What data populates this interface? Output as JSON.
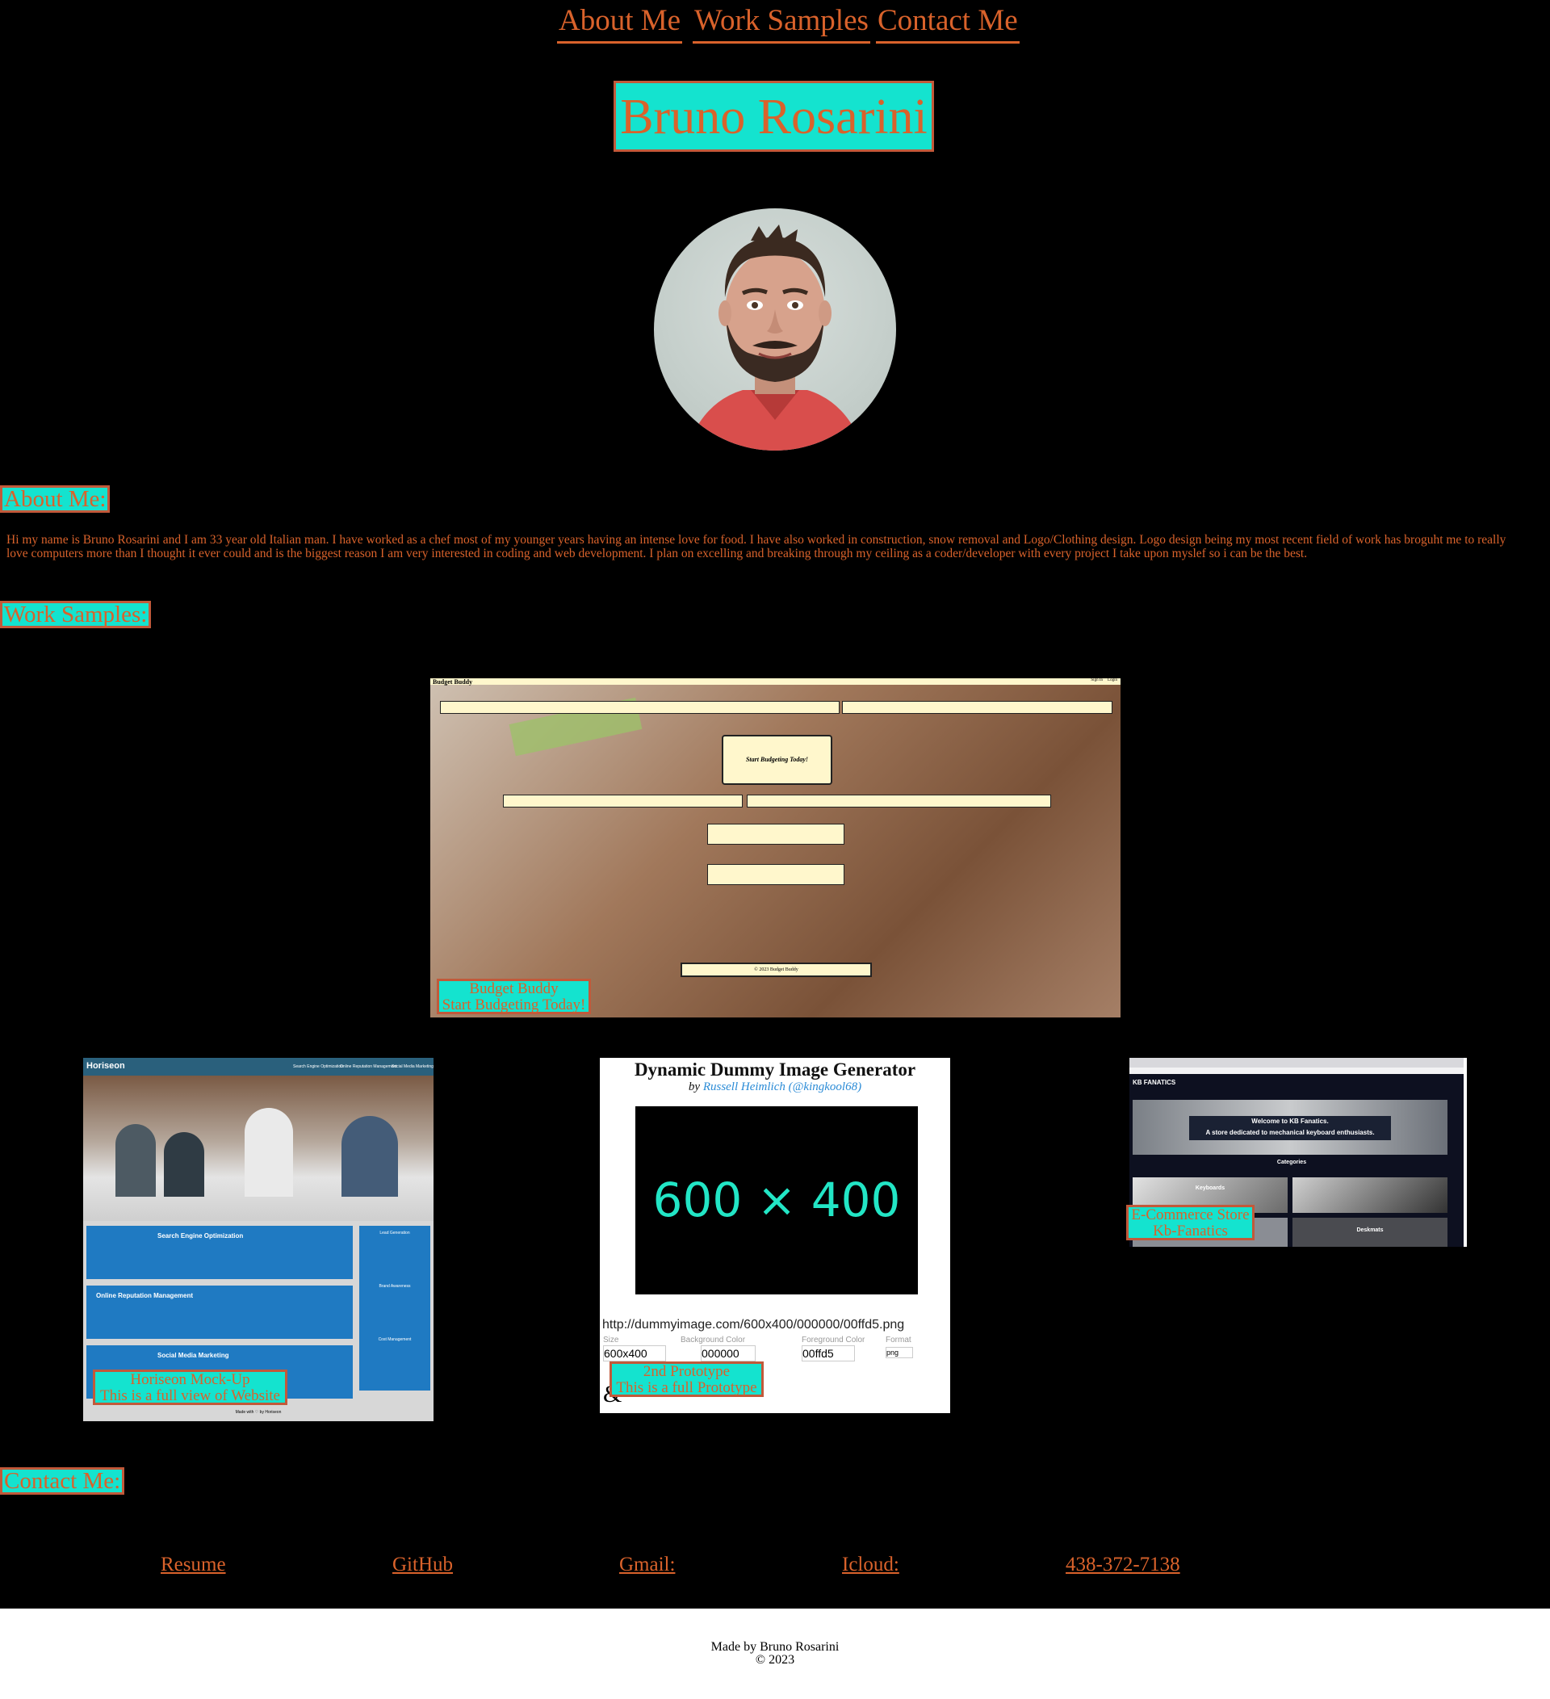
{
  "nav": {
    "about": "About Me",
    "work": "Work Samples",
    "contact": "Contact Me"
  },
  "header": {
    "title": "Bruno Rosarini"
  },
  "about": {
    "heading": "About Me:",
    "text": "Hi my name is Bruno Rosarini and I am 33 year old Italian man. I have worked as a chef most of my younger years having an intense love for food. I have also worked in construction, snow removal and Logo/Clothing design. Logo design being my most recent field of work has broguht me to really love computers more than I thought it ever could and is the biggest reason I am very interested in coding and web development. I plan on excelling and breaking through my ceiling as a coder/developer with every project I take upon myslef so i can be the best."
  },
  "work": {
    "heading": "Work Samples:",
    "budget": {
      "caption_1": "Budget Buddy",
      "caption_2": "Start Budgeting Today!",
      "brand": "Budget Buddy",
      "cta": "Start Budgeting Today!",
      "footer": "© 2023 Budget Buddy",
      "topright_1": "Sign In",
      "topright_2": "Login"
    },
    "horiseon": {
      "caption_1": "Horiseon Mock-Up",
      "caption_2": "This is a full view of Website",
      "logo": "Horiseon",
      "nav": [
        "Search Engine Optimization",
        "Online Reputation Management",
        "Social Media Marketing"
      ],
      "sections": [
        "Search Engine Optimization",
        "Online Reputation Management",
        "Social Media Marketing"
      ],
      "side": [
        "Lead Generation",
        "Brand Awareness",
        "Cost Management"
      ],
      "footer": "Made with ♡ by Horiseon"
    },
    "dummy": {
      "caption_1": "2nd Prototype",
      "caption_2": "This is a full Prototype",
      "title": "Dynamic Dummy Image Generator",
      "by": "by",
      "author": "Russell Heimlich",
      "handle": "(@kingkool68)",
      "preview": "600 × 400",
      "url": "http://dummyimage.com/600x400/000000/00ffd5.png",
      "size_label": "Size",
      "size_value": "600x400",
      "bg_label": "Background Color",
      "bg_value": "000000",
      "fg_label": "Foreground Color",
      "fg_value": "00ffd5",
      "format_label": "Format",
      "format_value": "png",
      "amp": "&"
    },
    "kb": {
      "caption_1": "E-Commerce Store",
      "caption_2": "Kb-Fanatics",
      "logo": "KB FANATICS",
      "hero_1": "Welcome to KB Fanatics.",
      "hero_2": "A store dedicated to mechanical keyboard enthusiasts.",
      "categories": "Categories",
      "cat_1": "Keyboards",
      "cat_2": "Deskmats"
    }
  },
  "contact": {
    "heading": "Contact Me:",
    "links": {
      "resume": "Resume",
      "github": "GitHub",
      "gmail": "Gmail:",
      "icloud": "Icloud:",
      "phone": "438-372-7138"
    }
  },
  "footer": {
    "line1": "Made by Bruno Rosarini",
    "line2": "© 2023"
  }
}
